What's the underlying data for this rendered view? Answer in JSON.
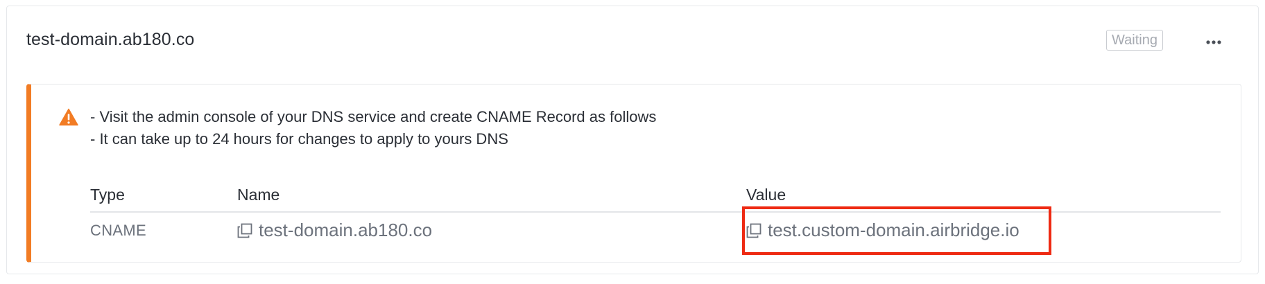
{
  "domain": {
    "title": "test-domain.ab180.co",
    "status": "Waiting"
  },
  "notice": {
    "lines": [
      "- Visit the admin console of your DNS service and create CNAME Record as follows",
      "- It can take up to 24 hours for changes to apply to yours DNS"
    ],
    "accent_color": "#f27c24"
  },
  "table": {
    "headers": [
      "Type",
      "Name",
      "Value"
    ],
    "rows": [
      {
        "type": "CNAME",
        "name": "test-domain.ab180.co",
        "value": "test.custom-domain.airbridge.io"
      }
    ]
  },
  "icons": {
    "more": "more-horizontal-icon",
    "warning": "warning-triangle-icon",
    "copy": "copy-icon"
  },
  "colors": {
    "highlight": "#ee2a13",
    "warning": "#f27c24"
  }
}
